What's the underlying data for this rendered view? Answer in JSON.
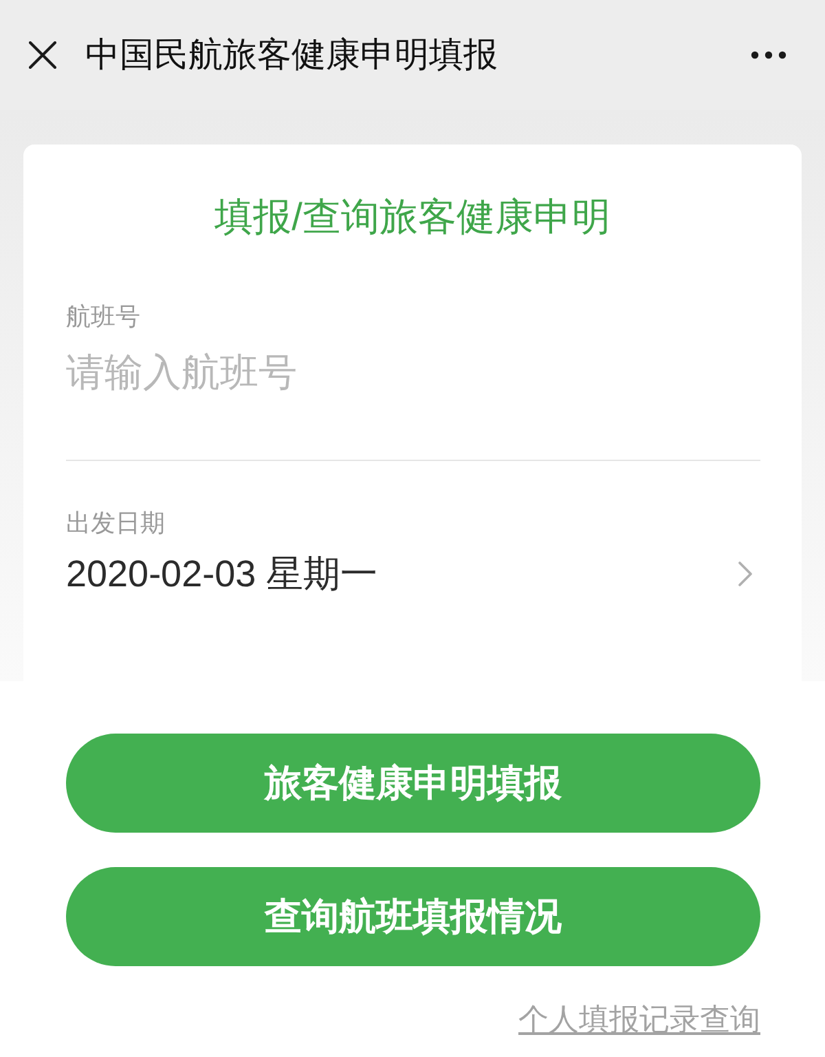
{
  "window": {
    "title": "中国民航旅客健康申明填报"
  },
  "form": {
    "title": "填报/查询旅客健康申明",
    "fields": [
      {
        "kind": "input",
        "label": "航班号",
        "placeholder": "请输入航班号"
      },
      {
        "kind": "picker",
        "label": "出发日期",
        "value": "2020-02-03 星期一"
      }
    ]
  },
  "buttons": [
    "旅客健康申明填报",
    "查询航班填报情况"
  ],
  "link": "个人填报记录查询"
}
